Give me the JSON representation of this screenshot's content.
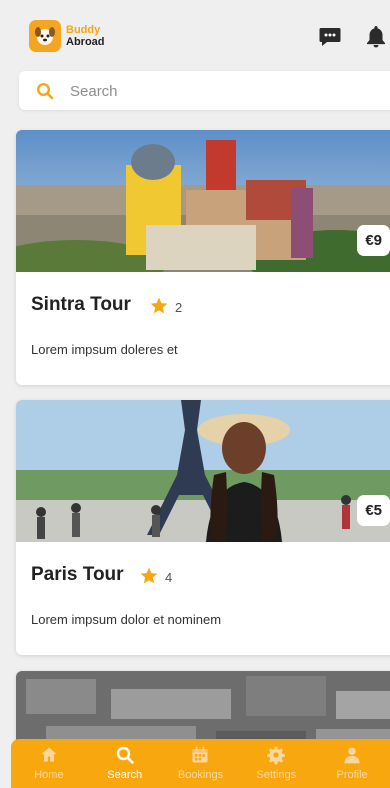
{
  "app": {
    "logo_line1": "Buddy",
    "logo_line2": "Abroad"
  },
  "header": {
    "icons": [
      "chat-icon",
      "bell-icon"
    ]
  },
  "search": {
    "placeholder": "Search"
  },
  "tours": [
    {
      "title": "Sintra Tour",
      "rating": "2",
      "description": "Lorem impsum doleres et",
      "price": "€9"
    },
    {
      "title": "Paris Tour",
      "rating": "4",
      "description": "Lorem impsum dolor et nominem",
      "price": "€5"
    }
  ],
  "tabbar": {
    "active": "Search",
    "items": [
      {
        "label": "Home",
        "icon": "home-icon"
      },
      {
        "label": "Search",
        "icon": "search-icon"
      },
      {
        "label": "Bookings",
        "icon": "calendar-icon"
      },
      {
        "label": "Settings",
        "icon": "gear-icon"
      },
      {
        "label": "Profile",
        "icon": "user-icon"
      }
    ]
  },
  "colors": {
    "accent": "#f8a80e",
    "background": "#efefef"
  }
}
